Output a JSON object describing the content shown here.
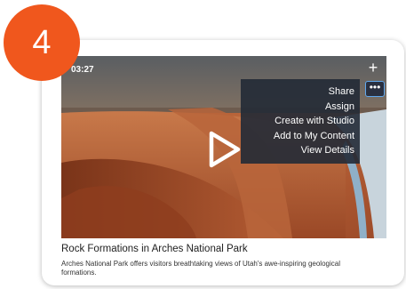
{
  "step_badge": {
    "number": "4",
    "color": "#f0571d"
  },
  "video": {
    "duration": "03:27",
    "add_icon": "plus-icon",
    "more_icon": "more-horizontal-icon",
    "play_icon": "play-icon"
  },
  "menu": {
    "items": [
      {
        "label": "Share"
      },
      {
        "label": "Assign"
      },
      {
        "label": "Create with Studio"
      },
      {
        "label": "Add to My Content"
      },
      {
        "label": "View Details"
      }
    ]
  },
  "card": {
    "title": "Rock Formations in Arches National Park",
    "description": "Arches National Park offers visitors breathtaking views of Utah's awe-inspiring geological formations."
  },
  "colors": {
    "menu_background": "#222a36",
    "focus_outline": "#60a8ee"
  }
}
